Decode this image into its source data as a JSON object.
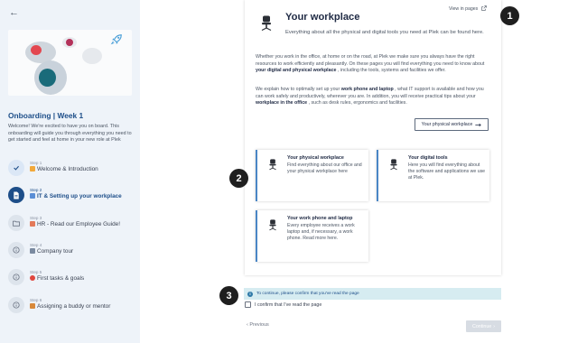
{
  "sidebar": {
    "back_icon": "arrow-left-icon",
    "onboarding_title": "Onboarding | Week 1",
    "onboarding_description": "Welcome! We're excited to have you on board. This onboarding will guide you through everything you need to get started and feel at home in your new role at Plek",
    "steps": [
      {
        "number": "Step 1",
        "label": "Welcome & Introduction",
        "status": "done",
        "icon": "check-icon",
        "emoji_color": "#f2a93b"
      },
      {
        "number": "Step 2",
        "label": "IT & Setting up your workplace",
        "status": "active",
        "icon": "document-icon",
        "emoji_color": "#5b8fd6"
      },
      {
        "number": "Step 3",
        "label": "HR - Read our Employee Guide!",
        "status": "todo",
        "icon": "folder-icon",
        "emoji_color": "#e37a5a"
      },
      {
        "number": "Step 4",
        "label": "Company tour",
        "status": "todo",
        "icon": "info-circle-icon",
        "emoji_color": "#7a8aa0"
      },
      {
        "number": "Step 5",
        "label": "First tasks & goals",
        "status": "todo",
        "icon": "info-circle-icon",
        "emoji_color": "#e0473f"
      },
      {
        "number": "Step 6",
        "label": "Assigning a buddy or mentor",
        "status": "todo",
        "icon": "info-circle-icon",
        "emoji_color": "#d8893a"
      }
    ]
  },
  "page": {
    "title": "Your workplace",
    "subtitle": "Everything about all the physical and digital tools you need at Plek can be found here.",
    "view_in_pages": "View in pages",
    "paragraph1_pre": "Whether you work in the office, at home or on the road, at Plek we make sure you always have the right resources to work efficiently and pleasantly. On these pages you will find everything you need to know about ",
    "paragraph1_bold": "your digital and physical workplace",
    "paragraph1_post": " , including the tools, systems and facilities we offer.",
    "paragraph2_pre": "We explain how to optimally set up your ",
    "paragraph2_bold1": "work phone and laptop",
    "paragraph2_mid": " , what IT support is available and how you can work safely and productively, wherever you are. In addition, you will receive practical tips about your ",
    "paragraph2_bold2": "workplace in the office",
    "paragraph2_post": " , such as desk rules, ergonomics and facilities.",
    "physical_button": "Your physical workplace",
    "cards": [
      {
        "title": "Your physical workplace",
        "description": "Find everything about our office and your physical workplace here"
      },
      {
        "title": "Your digital tools",
        "description": "Here you will find everything about the software and applications we use at Plek."
      },
      {
        "title": "Your work phone and laptop",
        "description": "Every employee receives a work laptop and, if necessary, a work phone. Read more here."
      }
    ]
  },
  "footer": {
    "info_text": "To continue, please confirm that you've read the page",
    "confirm_label": "I confirm that I've read the page",
    "previous_label": "Previous",
    "continue_label": "Continue"
  },
  "callouts": [
    "1",
    "2",
    "3"
  ],
  "colors": {
    "accent": "#1d4e89",
    "card_border": "#4a86c5",
    "info_bg": "#d6ecf1",
    "sidebar_bg": "#eef3f9"
  }
}
